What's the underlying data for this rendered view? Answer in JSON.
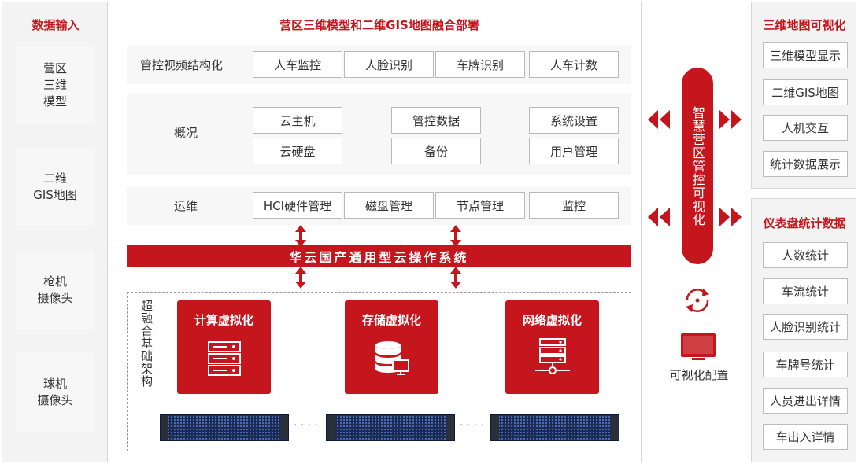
{
  "left": {
    "title": "数据输入",
    "items": [
      "营区\n三维\n模型",
      "二维\nGIS地图",
      "枪机\n摄像头",
      "球机\n摄像头"
    ]
  },
  "main": {
    "title": "营区三维模型和二维GIS地图融合部署",
    "rows": [
      {
        "label": "管控视频结构化",
        "boxes": [
          "人车监控",
          "人脸识别",
          "车牌识别",
          "人车计数"
        ]
      },
      {
        "label": "概况",
        "boxes": [
          "云主机",
          "管控数据",
          "系统设置",
          "云硬盘",
          "备份",
          "用户管理"
        ]
      },
      {
        "label": "运维",
        "boxes": [
          "HCI硬件管理",
          "磁盘管理",
          "节点管理",
          "监控"
        ]
      }
    ],
    "os_bar": "华云国产通用型云操作系统",
    "infra_label": "超融合基础架构",
    "virtualization": [
      "计算虚拟化",
      "存储虚拟化",
      "网络虚拟化"
    ],
    "dots": "· · · ·"
  },
  "center": {
    "pill": "智慧营区管控可视化",
    "config_label": "可视化配置"
  },
  "right_top": {
    "title": "三维地图可视化",
    "items": [
      "三维模型显示",
      "二维GIS地图",
      "人机交互",
      "统计数据展示"
    ]
  },
  "right_bottom": {
    "title": "仪表盘统计数据",
    "items": [
      "人数统计",
      "车流统计",
      "人脸识别统计",
      "车牌号统计",
      "人员进出详情",
      "车出入详情"
    ]
  },
  "colors": {
    "accent": "#c4161c",
    "panel": "#f3f3f3",
    "server": "#1b2b55"
  }
}
